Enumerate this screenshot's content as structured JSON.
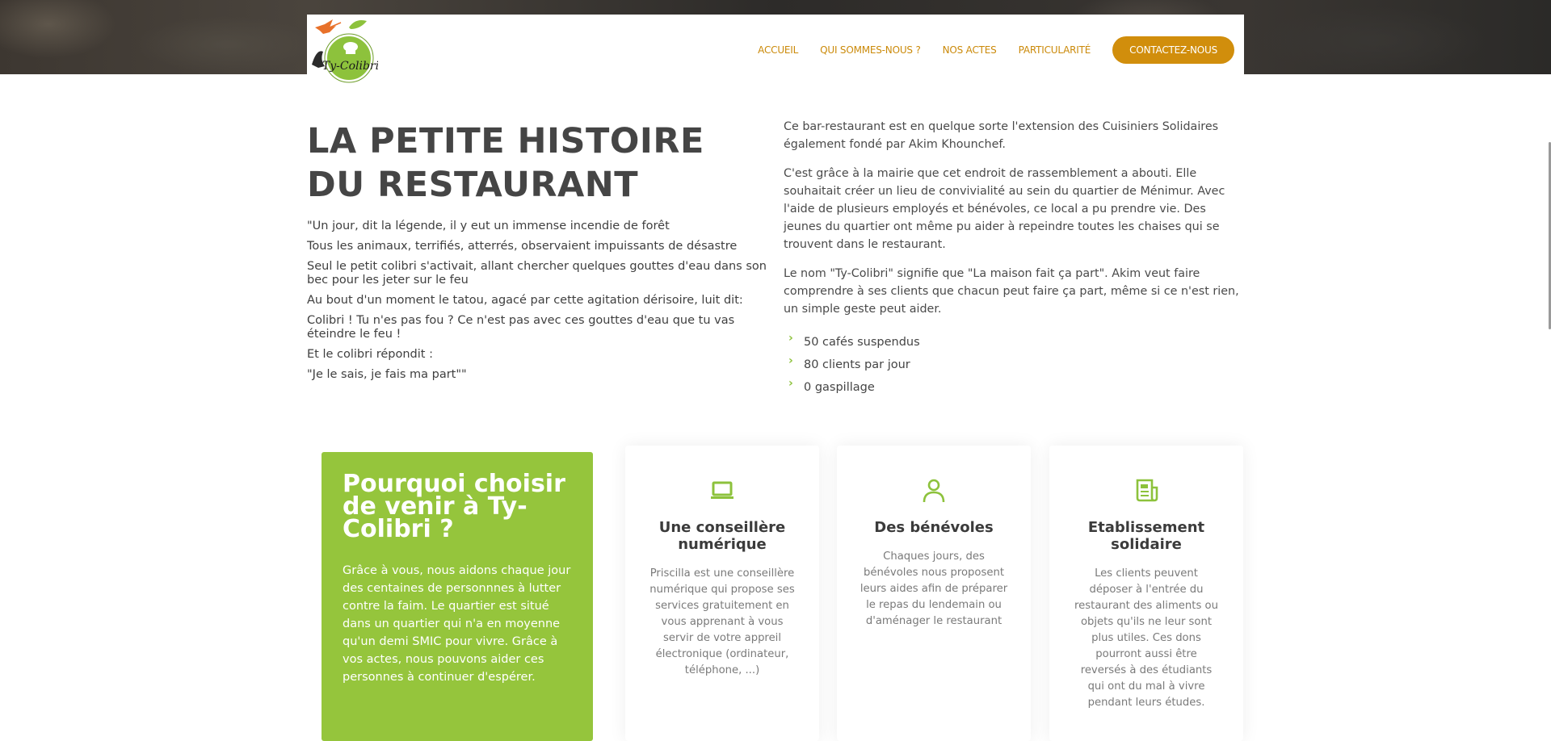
{
  "nav": {
    "logo_text": "Ty-Colibri",
    "items": [
      "ACCUEIL",
      "QUI SOMMES-NOUS ?",
      "NOS ACTES",
      "PARTICULARITÉ"
    ],
    "cta": "CONTACTEZ-NOUS"
  },
  "story": {
    "title": "LA PETITE HISTOIRE DU RESTAURANT",
    "lines": [
      "\"Un jour, dit la légende, il y eut un immense incendie de forêt",
      "Tous les animaux, terrifiés, atterrés, observaient impuissants de désastre",
      "Seul le petit colibri s'activait, allant chercher quelques gouttes d'eau dans son bec pour les jeter sur le feu",
      "Au bout d'un moment le tatou, agacé par cette agitation dérisoire, luit dit:",
      "Colibri ! Tu n'es pas fou ? Ce n'est pas avec ces gouttes d'eau que tu vas éteindre le feu !",
      "Et le colibri répondit :",
      "\"Je le sais, je fais ma part\"\""
    ],
    "paragraphs": [
      "Ce bar-restaurant est en quelque sorte l'extension des Cuisiniers Solidaires également fondé par Akim Khounchef.",
      "C'est grâce à la mairie que cet endroit de rassemblement a abouti. Elle souhaitait créer un lieu de convivialité au sein du quartier de Ménimur. Avec l'aide de plusieurs employés et bénévoles, ce local a pu prendre vie. Des jeunes du quartier ont même pu aider à repeindre toutes les chaises qui se trouvent dans le restaurant.",
      "Le nom \"Ty-Colibri\" signifie que \"La maison fait ça part\". Akim veut faire comprendre à ses clients que chacun peut faire ça part, même si ce n'est rien, un simple geste peut aider."
    ],
    "stats": [
      "50 cafés suspendus",
      "80 clients par jour",
      "0 gaspillage"
    ]
  },
  "why": {
    "title": "Pourquoi choisir de venir à Ty-Colibri ?",
    "text": "Grâce à vous, nous aidons chaque jour des centaines de personnnes à lutter contre la faim. Le quartier est situé dans un quartier qui n'a en moyenne qu'un demi SMIC pour vivre. Grâce à vos actes, nous pouvons aider ces personnes à continuer d'espérer."
  },
  "cards": [
    {
      "icon": "laptop-icon",
      "title": "Une conseillère numérique",
      "text": "Priscilla est une conseillère numérique qui propose ses services gratuitement en vous apprenant à vous servir de votre appreil électronique (ordinateur, téléphone, ...)"
    },
    {
      "icon": "person-icon",
      "title": "Des bénévoles",
      "text": "Chaques jours, des bénévoles nous proposent leurs aides afin de préparer le repas du lendemain ou d'aménager le restaurant"
    },
    {
      "icon": "newspaper-icon",
      "title": "Etablissement solidaire",
      "text": "Les clients peuvent déposer à l'entrée du restaurant des aliments ou objets qu'ils ne leur sont plus utiles. Ces dons pourront aussi être reversés à des étudiants qui ont du mal à vivre pendant leurs études."
    }
  ],
  "colors": {
    "accent_orange": "#d18e0c",
    "accent_green": "#95c53c"
  }
}
